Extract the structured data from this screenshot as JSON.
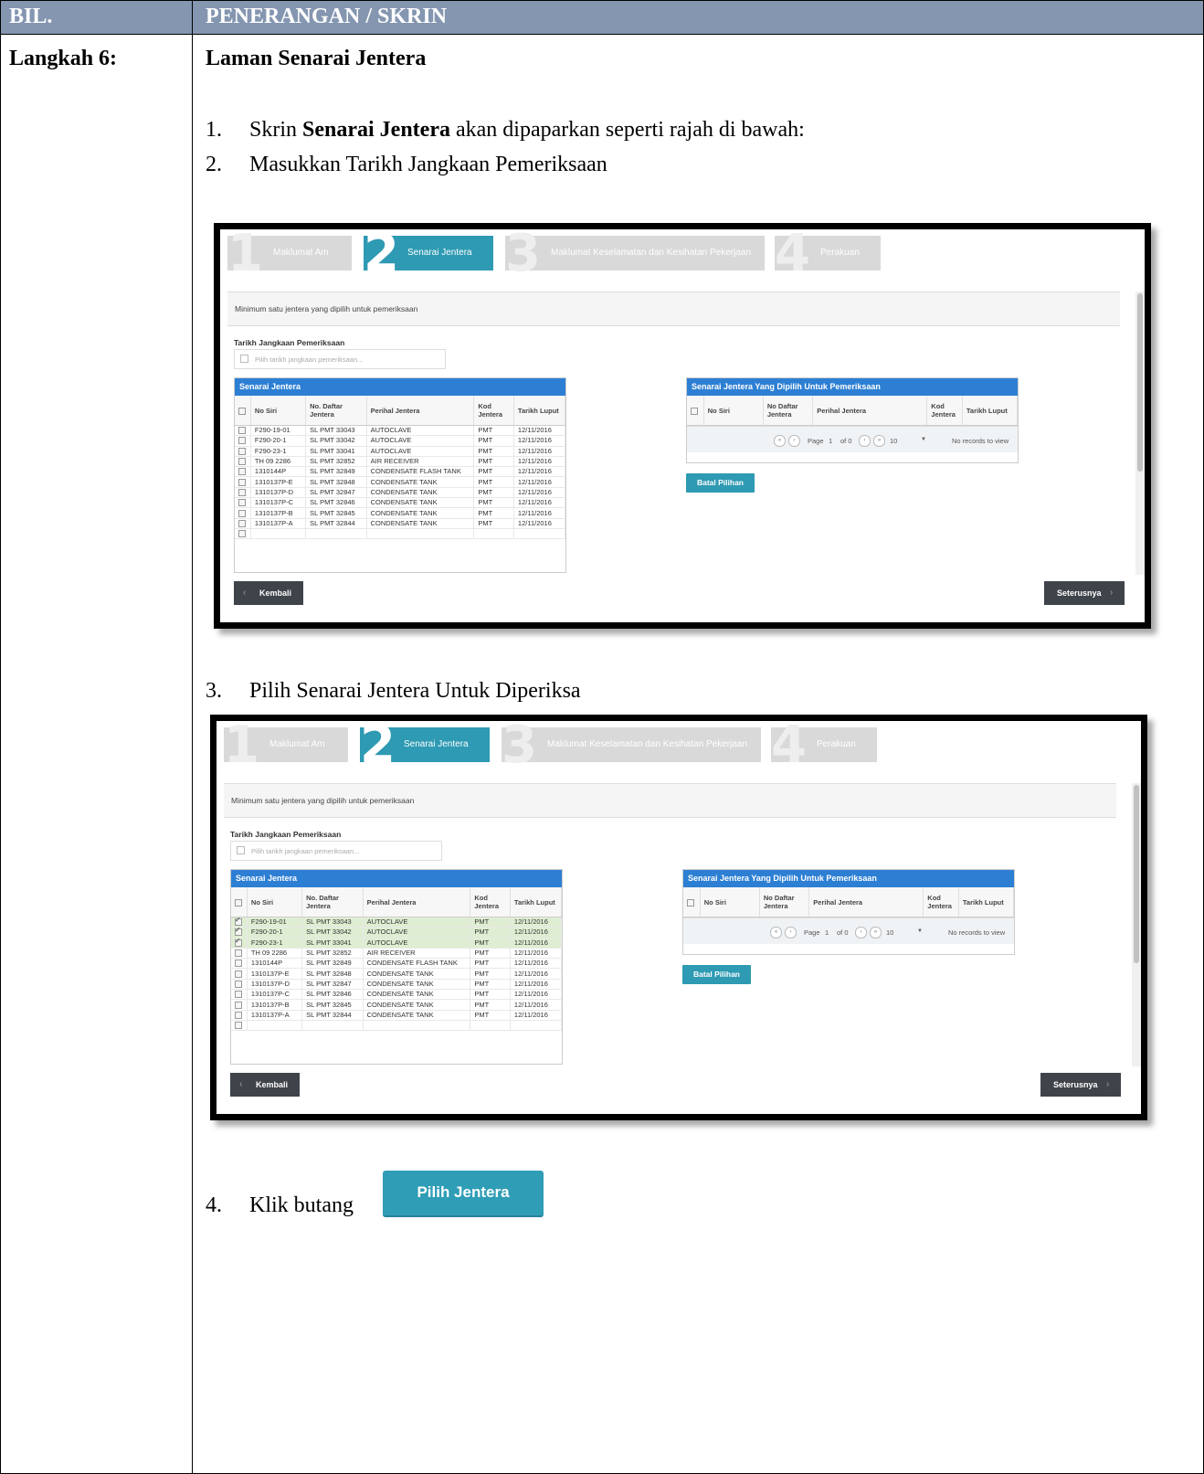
{
  "header": {
    "col1": "BIL.",
    "col2": "PENERANGAN / SKRIN"
  },
  "step": {
    "label": "Langkah 6:",
    "title": "Laman Senarai Jentera"
  },
  "items": [
    {
      "num": "1.",
      "pre": "Skrin ",
      "bold": "Senarai Jentera",
      "post": " akan dipaparkan seperti rajah di bawah:"
    },
    {
      "num": "2.",
      "text": "Masukkan Tarikh Jangkaan Pemeriksaan"
    },
    {
      "num": "3.",
      "text": "Pilih Senarai Jentera Untuk Diperiksa"
    },
    {
      "num": "4.",
      "text": "Klik butang"
    }
  ],
  "pilih_button": "Pilih Jentera",
  "screen": {
    "wizard": [
      {
        "num": "1",
        "label": "Maklumat Am"
      },
      {
        "num": "2",
        "label": "Senarai Jentera"
      },
      {
        "num": "3",
        "label": "Maklumat Keselamatan dan Kesihatan Pekerjaan"
      },
      {
        "num": "4",
        "label": "Perakuan"
      }
    ],
    "info": "Minimum satu jentera yang dipilih untuk pemeriksaan",
    "date_label": "Tarikh Jangkaan Pemeriksaan",
    "date_placeholder": "Pilih tarikh jangkaan pemeriksaan...",
    "left_grid_title": "Senarai Jentera",
    "right_grid_title": "Senarai Jentera Yang Dipilih Untuk Pemeriksaan",
    "columns": [
      "No Siri",
      "No. Daftar Jentera",
      "Perihal Jentera",
      "Kod Jentera",
      "Tarikh Luput"
    ],
    "right_columns": [
      "No Siri",
      "No Daftar Jentera",
      "Perihal Jentera",
      "Kod Jentera",
      "Tarikh Luput"
    ],
    "rows": [
      [
        "F290-19-01",
        "SL PMT 33043",
        "AUTOCLAVE",
        "PMT",
        "12/11/2016"
      ],
      [
        "F290-20-1",
        "SL PMT 33042",
        "AUTOCLAVE",
        "PMT",
        "12/11/2016"
      ],
      [
        "F290-23-1",
        "SL PMT 33041",
        "AUTOCLAVE",
        "PMT",
        "12/11/2016"
      ],
      [
        "TH 09 2286",
        "SL PMT 32852",
        "AIR RECEIVER",
        "PMT",
        "12/11/2016"
      ],
      [
        "1310144P",
        "SL PMT 32849",
        "CONDENSATE FLASH TANK",
        "PMT",
        "12/11/2016"
      ],
      [
        "1310137P-E",
        "SL PMT 32848",
        "CONDENSATE TANK",
        "PMT",
        "12/11/2016"
      ],
      [
        "1310137P-D",
        "SL PMT 32847",
        "CONDENSATE TANK",
        "PMT",
        "12/11/2016"
      ],
      [
        "1310137P-C",
        "SL PMT 32846",
        "CONDENSATE TANK",
        "PMT",
        "12/11/2016"
      ],
      [
        "1310137P-B",
        "SL PMT 32845",
        "CONDENSATE TANK",
        "PMT",
        "12/11/2016"
      ],
      [
        "1310137P-A",
        "SL PMT 32844",
        "CONDENSATE TANK",
        "PMT",
        "12/11/2016"
      ]
    ],
    "pager": {
      "page_label": "Page",
      "page": "1",
      "of": "of 0",
      "size": "10",
      "empty": "No records to view"
    },
    "batal": "Batal Pilihan",
    "kembali": "Kembali",
    "seterusnya": "Seterusnya"
  },
  "shot2_selected": [
    0,
    1,
    2
  ]
}
